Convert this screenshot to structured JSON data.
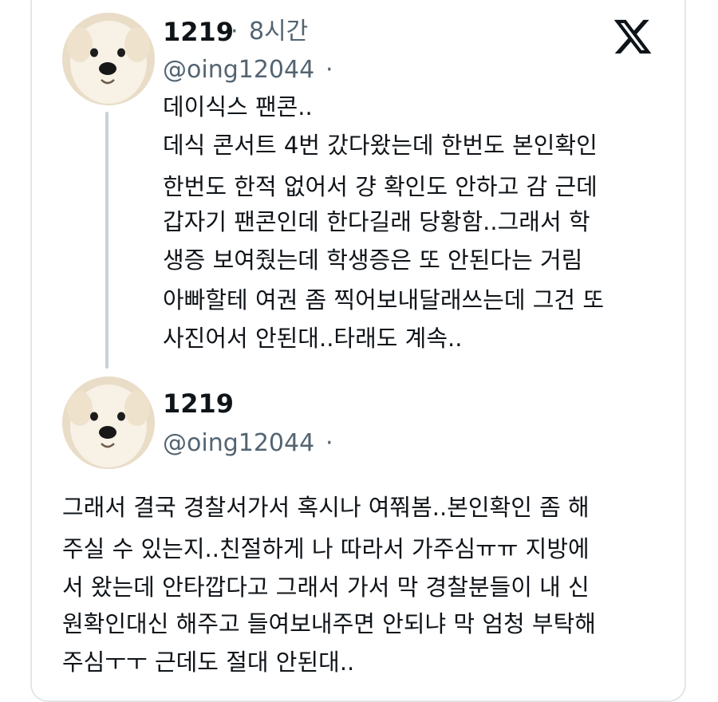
{
  "tweets": [
    {
      "display_name": "1219",
      "time_sep": "·",
      "time": "8시간",
      "handle": "@oing12044",
      "handle_sep": "·",
      "lines": [
        "데이식스 팬콘..",
        "데식 콘서트 4번 갔다왔는데 한번도 본인확인",
        "한번도 한적 없어서 걍 확인도 안하고 감 근데",
        "갑자기 팬콘인데 한다길래 당황함..그래서 학",
        "생증 보여줬는데 학생증은 또 안된다는 거림",
        "아빠할테 여권 좀 찍어보내달래쓰는데 그건 또",
        "사진어서 안된대..타래도 계속.."
      ]
    },
    {
      "display_name": "1219",
      "handle": "@oing12044",
      "handle_sep": "·",
      "lines": [
        "그래서 결국 경찰서가서 혹시나 여쭤봄..본인확인 좀 해",
        "주실 수 있는지..친절하게 나 따라서 가주심ㅠㅠ 지방에",
        "서 왔는데 안타깝다고 그래서 가서 막 경찰분들이 내 신",
        "원확인대신 해주고 들여보내주면 안되냐 막 엄청 부탁해",
        "주심ㅜㅜ 근데도 절대 안된대.."
      ]
    }
  ],
  "icons": {
    "platform": "x-logo-icon",
    "avatar": "puppy-avatar"
  },
  "colors": {
    "text": "#0f1419",
    "muted": "#536471",
    "thread_line": "#c9d1d8",
    "border": "#e3e6e8"
  }
}
